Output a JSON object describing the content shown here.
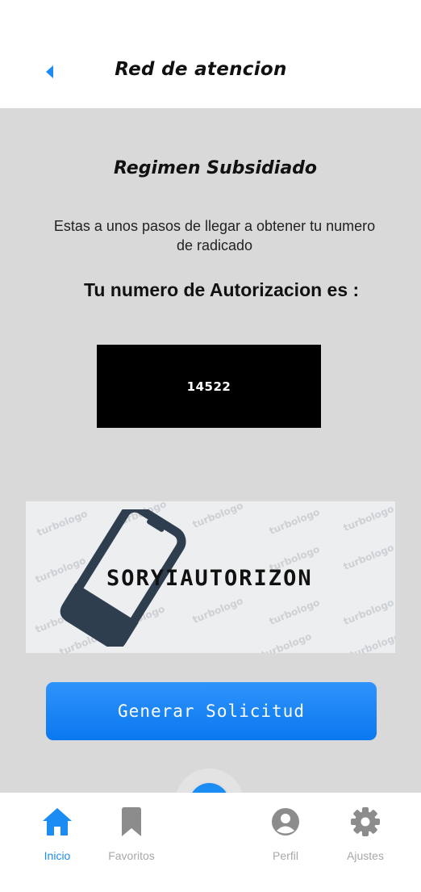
{
  "header": {
    "title": "Red de atencion",
    "back_icon": "chevron-left-icon"
  },
  "main": {
    "section_title": "Regimen Subsidiado",
    "intro_text": "Estas a unos pasos de llegar a obtener tu numero de radicado",
    "auth_label": "Tu numero de Autorizacion es :",
    "auth_number": "14522",
    "logo": {
      "text": "SORYIAUTORIZON",
      "watermark": "turbologo"
    },
    "generate_button_label": "Generar Solicitud"
  },
  "tabbar": {
    "items": [
      {
        "label": "Inicio",
        "icon": "home-icon",
        "active": true
      },
      {
        "label": "Favoritos",
        "icon": "bookmark-icon",
        "active": false
      },
      {
        "label": "Perfil",
        "icon": "user-icon",
        "active": false
      },
      {
        "label": "Ajustes",
        "icon": "gear-icon",
        "active": false
      }
    ],
    "fab_icon": "plus-icon"
  },
  "colors": {
    "accent": "#1c8cf5",
    "background": "#d9d9d9",
    "inactive": "#a8a8a8",
    "icon_inactive": "#8c8c8c"
  }
}
